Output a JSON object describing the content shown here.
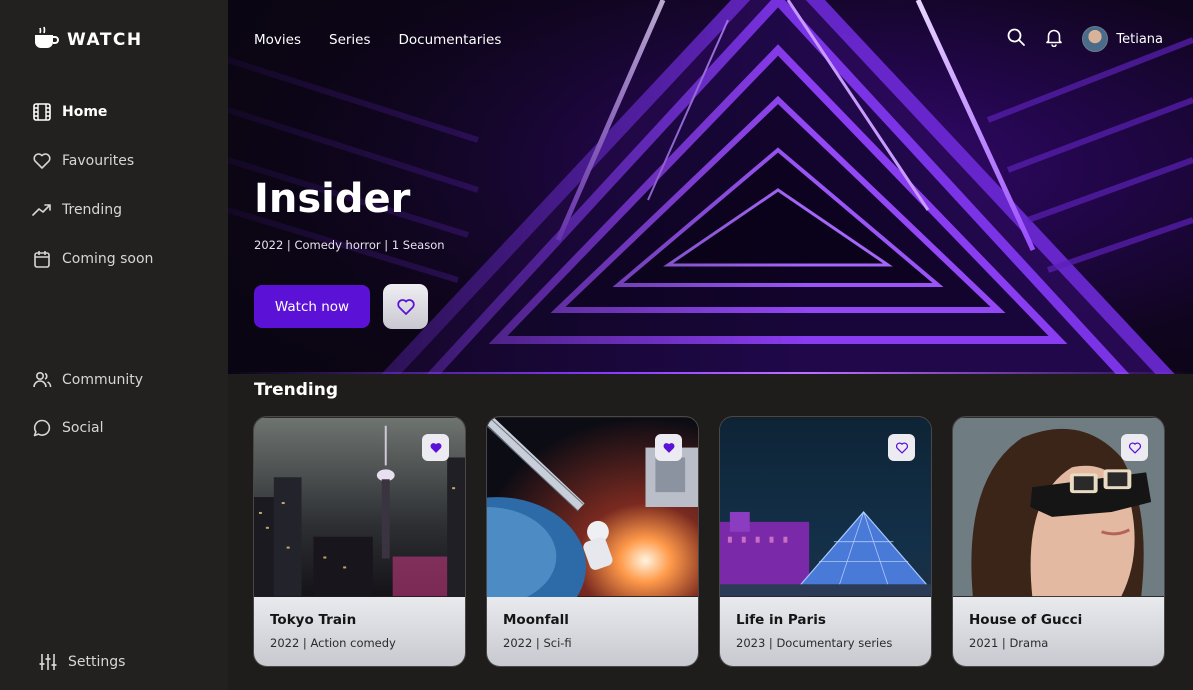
{
  "brand": {
    "name": "WATCH"
  },
  "sidebar": {
    "items": [
      {
        "label": "Home",
        "icon": "film-icon",
        "active": true
      },
      {
        "label": "Favourites",
        "icon": "heart-icon"
      },
      {
        "label": "Trending",
        "icon": "trending-icon"
      },
      {
        "label": "Coming soon",
        "icon": "calendar-icon"
      },
      {
        "label": "Community",
        "icon": "users-icon"
      },
      {
        "label": "Social",
        "icon": "chat-icon"
      }
    ],
    "settings_label": "Settings"
  },
  "top_nav": {
    "items": [
      "Movies",
      "Series",
      "Documentaries"
    ]
  },
  "user": {
    "name": "Tetiana"
  },
  "hero": {
    "title": "Insider",
    "meta": "2022 | Comedy horror | 1 Season",
    "watch_label": "Watch now"
  },
  "trending": {
    "title": "Trending",
    "cards": [
      {
        "title": "Tokyo Train",
        "meta": "2022 | Action comedy",
        "favourited": true
      },
      {
        "title": "Moonfall",
        "meta": "2022 | Sci-fi",
        "favourited": true
      },
      {
        "title": "Life in Paris",
        "meta": "2023 | Documentary series",
        "favourited": false
      },
      {
        "title": "House of Gucci",
        "meta": "2021 | Drama",
        "favourited": false
      }
    ]
  },
  "colors": {
    "accent": "#5b12d6",
    "heart": "#5b12d6",
    "sidebar_bg": "#222120",
    "page_bg": "#1f1d1c"
  }
}
